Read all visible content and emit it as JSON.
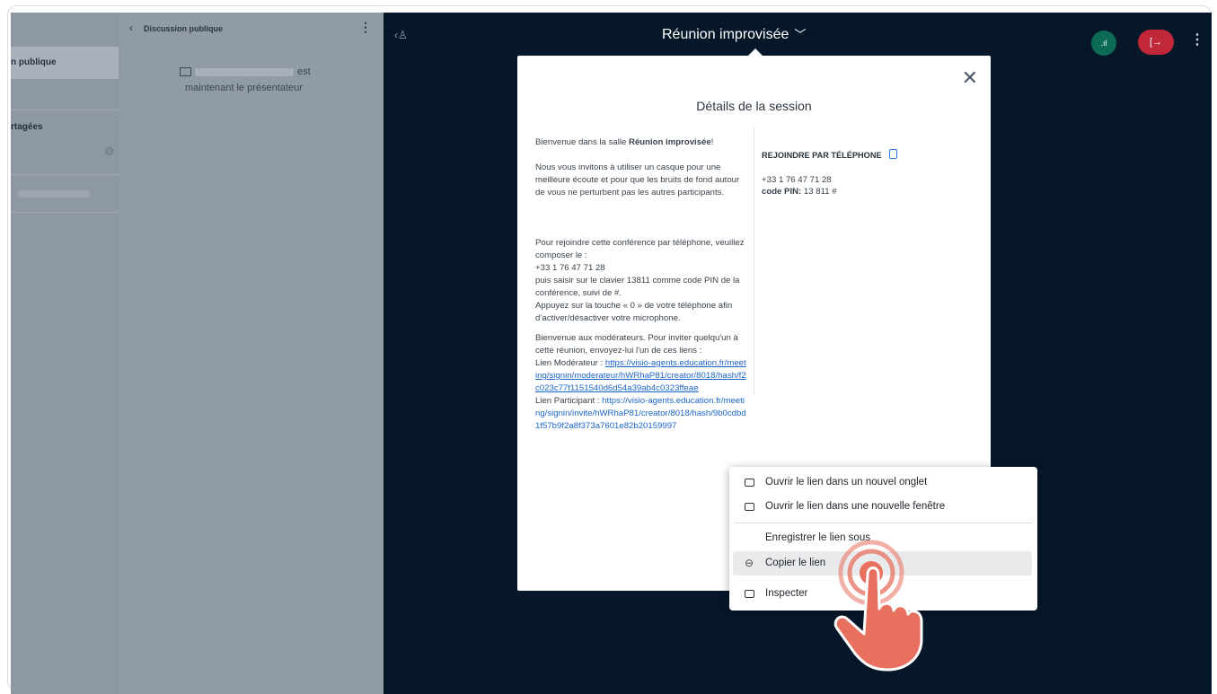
{
  "sidebar": {
    "active_item": "n publique",
    "shared_notes_label": "rtagées"
  },
  "chat": {
    "back_icon": "chevron-left-icon",
    "title": "Discussion publique",
    "presenter_line1_suffix": "est",
    "presenter_line2": "maintenant le présentateur"
  },
  "header": {
    "title": "Réunion improvisée",
    "dropdown_icon": "chevron-down-icon"
  },
  "modal": {
    "title": "Détails de la session",
    "welcome_prefix": "Bienvenue dans la salle ",
    "welcome_room": "Réunion improvisée",
    "welcome_suffix": "!",
    "headset_text": "Nous vous invitons à utiliser un casque pour une meilleure écoute et pour que les bruits de fond autour de vous ne perturbent pas les autres participants.",
    "phone_intro": "Pour rejoindre cette conférence par téléphone, veuillez composer le :",
    "phone_number": "+33 1 76 47 71 28",
    "pin_instructions": "puis saisir sur le clavier 13811 comme code PIN de la conférence, suivi de #.",
    "mute_instructions": "Appuyez sur la touche « 0 » de votre téléphone afin d’activer/désactiver votre microphone.",
    "moderators_text": "Bienvenue aux modérateurs. Pour inviter quelqu'un à cette réunion, envoyez-lui l'un de ces liens :",
    "moderator_label": "Lien Modérateur  : ",
    "moderator_link": "https://visio-agents.education.fr/meeting/signin/moderateur/hWRhaP81/creator/8018/hash/f2c023c77f1151540d6d54a39ab4c0323ffeae",
    "participant_label": "Lien Participant  : ",
    "participant_link": "https://visio-agents.education.fr/meeting/signin/invite/hWRhaP81/creator/8018/hash/9b0cdbd1f57b9f2a8f373a7601e82b20159997",
    "join_phone_title": "REJOINDRE PAR TÉLÉPHONE",
    "join_phone_number": "+33 1 76 47 71 28",
    "pin_label": "code PIN:",
    "pin_value": " 13 811 #"
  },
  "context_menu": {
    "items": [
      {
        "label": "Ouvrir le lien dans un nouvel onglet",
        "icon": "new-tab-icon"
      },
      {
        "label": "Ouvrir le lien dans une nouvelle fenêtre",
        "icon": "new-window-icon"
      },
      {
        "label": "Enregistrer le lien sous",
        "icon": ""
      },
      {
        "label": "Copier le lien",
        "icon": "link-icon"
      },
      {
        "label": "Inspecter",
        "icon": "inspect-icon"
      }
    ]
  },
  "colors": {
    "main_bg": "#06172a",
    "link": "#1c66c9",
    "leave_button": "#c0283a",
    "connection_indicator": "#0c6b55",
    "hand_cursor": "#e8705f"
  }
}
